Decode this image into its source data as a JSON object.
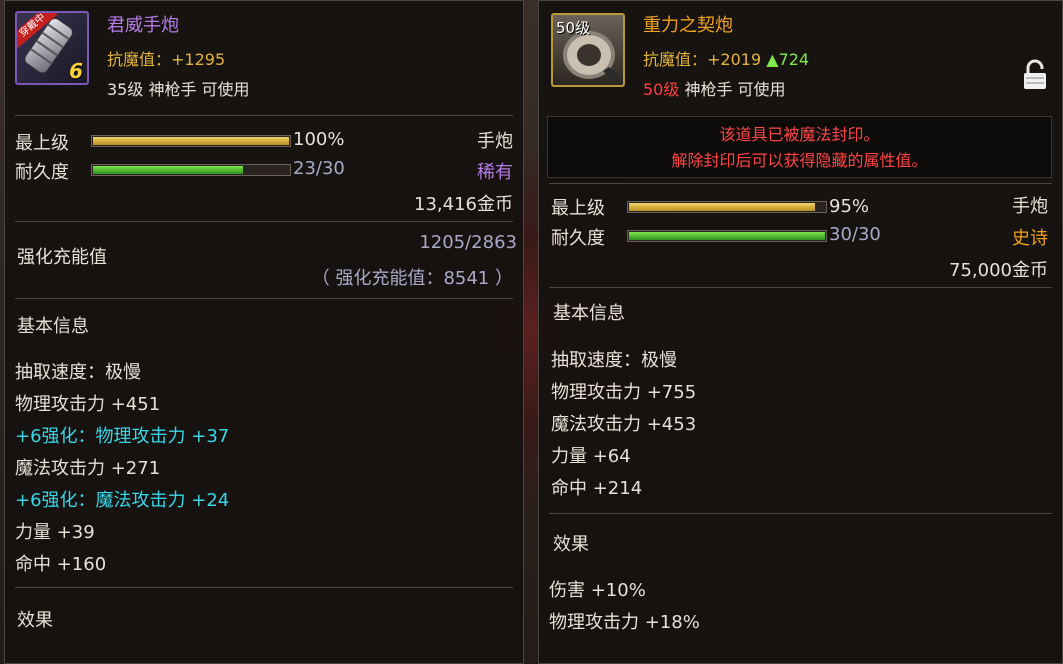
{
  "left": {
    "name": "君威手炮",
    "badge": "穿戴中",
    "enhance_level": "6",
    "resist": "抗魔值：+1295",
    "requirement": "35级 神枪手 可使用",
    "rows": {
      "level_label": "最上级",
      "level_value": "100%",
      "level_fill": 1.0,
      "type": "手炮",
      "durability_label": "耐久度",
      "durability_value": "23/30",
      "durability_fill": 0.77,
      "rarity": "稀有",
      "price": "13,416金币"
    },
    "charge_label": "强化充能值",
    "charge_value": "1205/2863",
    "charge_sub": "（ 强化充能值：8541 ）",
    "basic_title": "基本信息",
    "stats": [
      {
        "text": "抽取速度：极慢",
        "color": "#e6e1d6"
      },
      {
        "text": "物理攻击力 +451",
        "color": "#e6e1d6"
      },
      {
        "text": "+6强化：物理攻击力 +37",
        "color": "#3ad6e8"
      },
      {
        "text": "魔法攻击力 +271",
        "color": "#e6e1d6"
      },
      {
        "text": "+6强化：魔法攻击力 +24",
        "color": "#3ad6e8"
      },
      {
        "text": "力量 +39",
        "color": "#e6e1d6"
      },
      {
        "text": "命中 +160",
        "color": "#e6e1d6"
      }
    ],
    "effect_title": "效果"
  },
  "right": {
    "icon_level": "50级",
    "name": "重力之契炮",
    "resist_prefix": "抗魔值：+2019",
    "resist_delta": "▲724",
    "req_level": "50级",
    "req_rest": "神枪手 可使用",
    "seal_line1": "该道具已被魔法封印。",
    "seal_line2": "解除封印后可以获得隐藏的属性值。",
    "rows": {
      "level_label": "最上级",
      "level_value": "95%",
      "level_fill": 0.95,
      "type": "手炮",
      "durability_label": "耐久度",
      "durability_value": "30/30",
      "durability_fill": 1.0,
      "rarity": "史诗",
      "price": "75,000金币"
    },
    "basic_title": "基本信息",
    "stats": [
      "抽取速度：极慢",
      "物理攻击力 +755",
      "魔法攻击力 +453",
      "力量 +64",
      "命中 +214"
    ],
    "effect_title": "效果",
    "effects": [
      "伤害 +10%",
      "物理攻击力 +18%"
    ]
  },
  "icons": {
    "lock": "padlock-icon",
    "left_item": "cannon-item-icon",
    "right_item": "cannon-item-icon"
  }
}
